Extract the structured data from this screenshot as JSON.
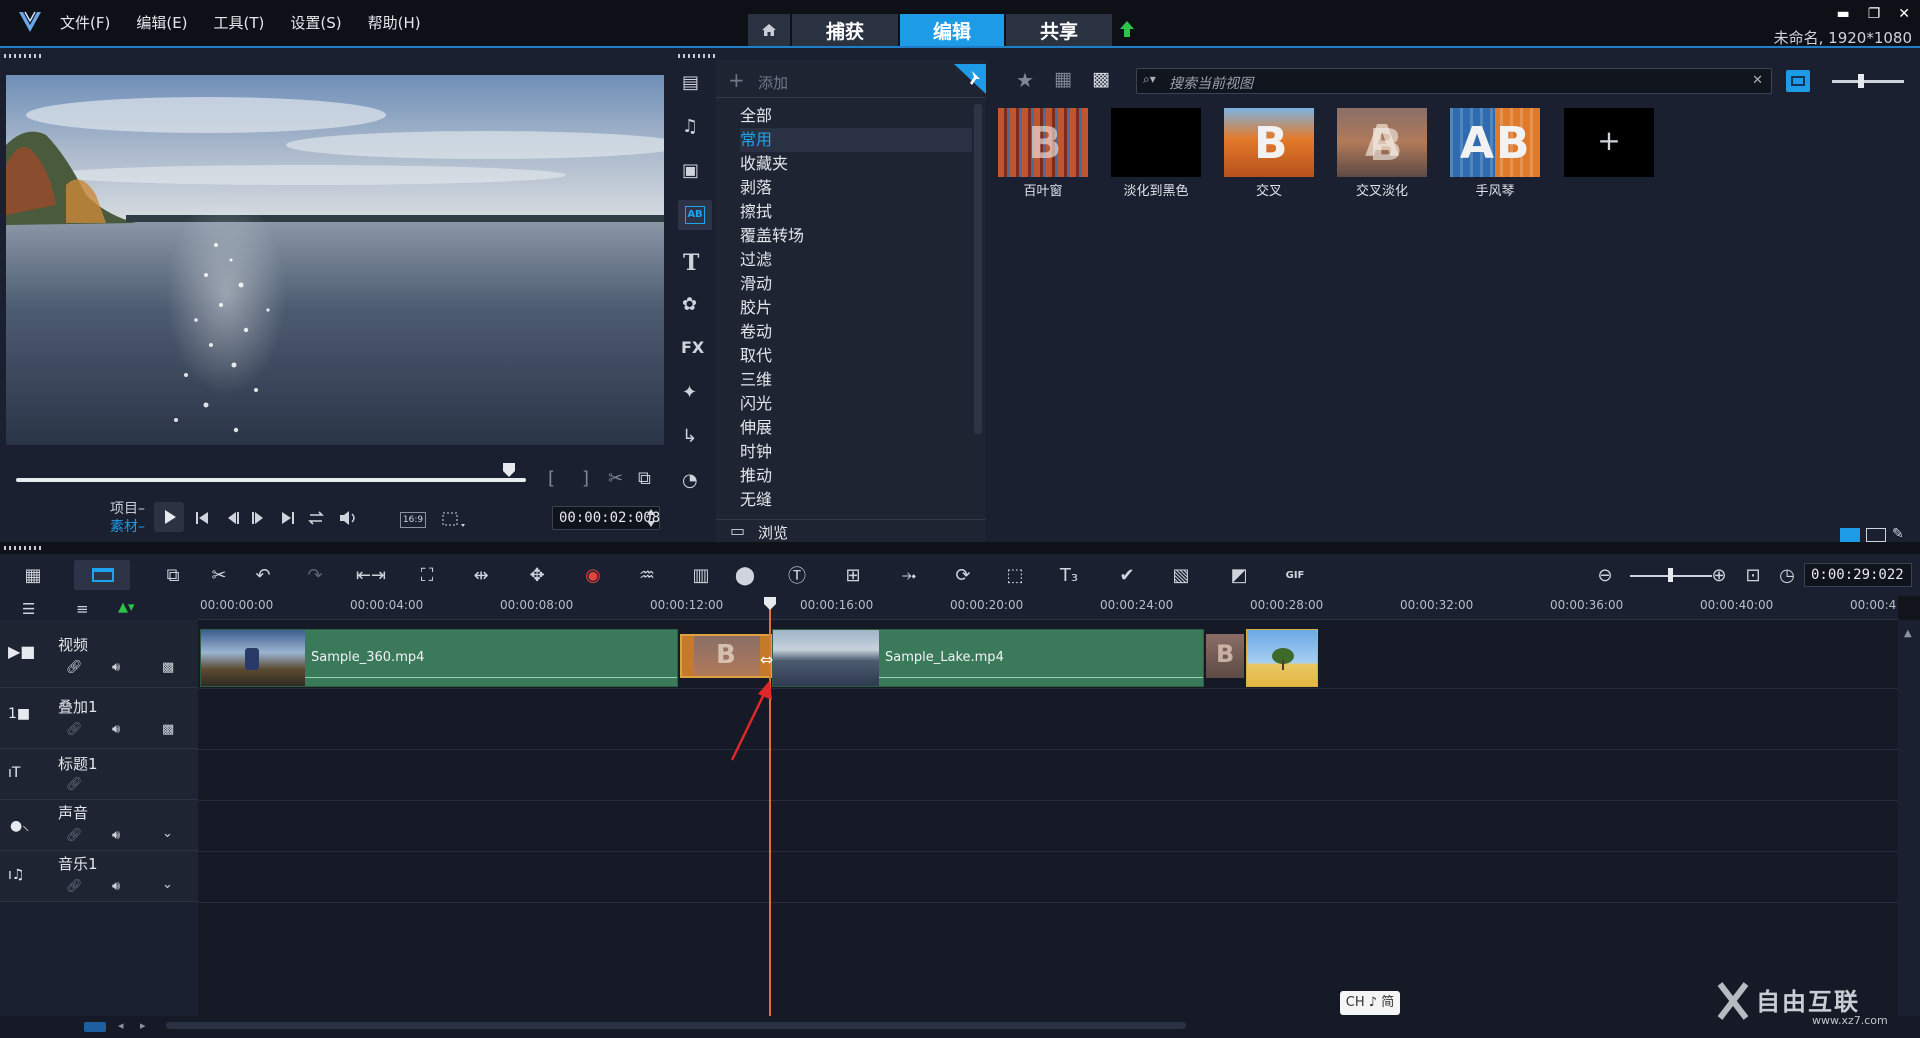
{
  "menu": [
    "文件(F)",
    "编辑(E)",
    "工具(T)",
    "设置(S)",
    "帮助(H)"
  ],
  "mode_tabs": [
    {
      "label": "捕获",
      "active": false
    },
    {
      "label": "编辑",
      "active": true
    },
    {
      "label": "共享",
      "active": false
    }
  ],
  "project_info": "未命名, 1920*1080",
  "accent_color": "#1e9be6",
  "preview": {
    "project_label": "项目",
    "clip_label": "素材",
    "timecode": "00:00:02:008",
    "aspect_label": "16:9"
  },
  "library": {
    "add_label": "添加",
    "search_placeholder": "搜索当前视图",
    "categories": [
      "全部",
      "常用",
      "收藏夹",
      "剥落",
      "擦拭",
      "覆盖转场",
      "过滤",
      "滑动",
      "胶片",
      "卷动",
      "取代",
      "三维",
      "闪光",
      "伸展",
      "时钟",
      "推动",
      "无缝"
    ],
    "selected_category": "常用",
    "browse_label": "浏览",
    "transitions": [
      "百叶窗",
      "淡化到黑色",
      "交叉",
      "交叉淡化",
      "手风琴"
    ]
  },
  "timeline": {
    "duration": "0:00:29:022",
    "ruler": [
      "00:00:00:00",
      "00:00:04:00",
      "00:00:08:00",
      "00:00:12:00",
      "00:00:16:00",
      "00:00:20:00",
      "00:00:24:00",
      "00:00:28:00",
      "00:00:32:00",
      "00:00:36:00",
      "00:00:40:00",
      "00:00:4"
    ],
    "tracks": [
      "视频",
      "叠加1",
      "标题1",
      "声音",
      "音乐1"
    ],
    "clips": [
      "Sample_360.mp4",
      "Sample_Lake.mp4"
    ]
  },
  "ime": "CH ♪ 简",
  "watermark": {
    "brand": "自由互联",
    "url": "www.xz7.com"
  }
}
